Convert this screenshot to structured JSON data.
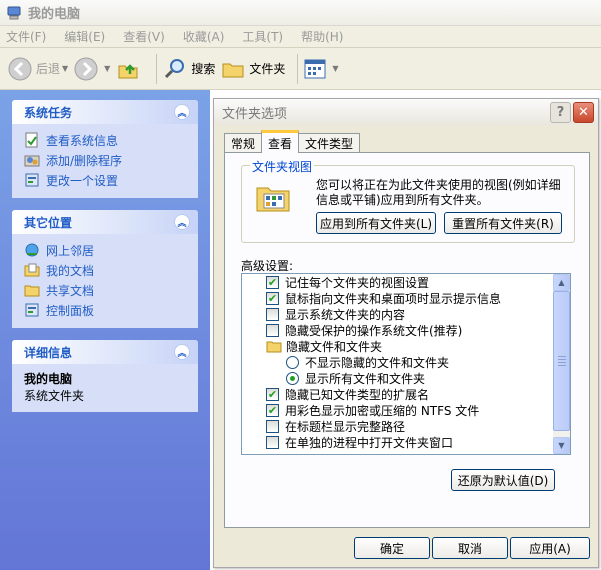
{
  "window": {
    "title": "我的电脑",
    "icon": "computer-icon"
  },
  "menubar": {
    "items": [
      "文件(F)",
      "编辑(E)",
      "查看(V)",
      "收藏(A)",
      "工具(T)",
      "帮助(H)"
    ]
  },
  "toolbar": {
    "back_label": "后退",
    "search_label": "搜索",
    "folders_label": "文件夹"
  },
  "taskpane": {
    "system_tasks": {
      "title": "系统任务",
      "items": [
        "查看系统信息",
        "添加/删除程序",
        "更改一个设置"
      ]
    },
    "other_places": {
      "title": "其它位置",
      "items": [
        "网上邻居",
        "我的文档",
        "共享文档",
        "控制面板"
      ]
    },
    "details": {
      "title": "详细信息",
      "name": "我的电脑",
      "type": "系统文件夹"
    }
  },
  "dialog": {
    "title": "文件夹选项",
    "help_symbol": "?",
    "close_symbol": "✕",
    "tabs": [
      "常规",
      "查看",
      "文件类型"
    ],
    "active_tab": "查看",
    "folder_views": {
      "legend": "文件夹视图",
      "description": "您可以将正在为此文件夹使用的视图(例如详细信息或平铺)应用到所有文件夹。",
      "apply_all_label": "应用到所有文件夹(L)",
      "reset_all_label": "重置所有文件夹(R)"
    },
    "advanced_label": "高级设置:",
    "advanced_items": [
      {
        "type": "checkbox",
        "checked": true,
        "label": "记住每个文件夹的视图设置"
      },
      {
        "type": "checkbox",
        "checked": true,
        "label": "鼠标指向文件夹和桌面项时显示提示信息"
      },
      {
        "type": "checkbox",
        "checked": false,
        "label": "显示系统文件夹的内容"
      },
      {
        "type": "checkbox",
        "checked": false,
        "label": "隐藏受保护的操作系统文件(推荐)"
      },
      {
        "type": "folder",
        "label": "隐藏文件和文件夹"
      },
      {
        "type": "radio",
        "checked": false,
        "label": "不显示隐藏的文件和文件夹"
      },
      {
        "type": "radio",
        "checked": true,
        "label": "显示所有文件和文件夹"
      },
      {
        "type": "checkbox",
        "checked": true,
        "label": "隐藏已知文件类型的扩展名"
      },
      {
        "type": "checkbox",
        "checked": true,
        "label": "用彩色显示加密或压缩的 NTFS 文件"
      },
      {
        "type": "checkbox",
        "checked": false,
        "label": "在标题栏显示完整路径"
      },
      {
        "type": "checkbox",
        "checked": false,
        "label": "在单独的进程中打开文件夹窗口"
      }
    ],
    "restore_defaults_label": "还原为默认值(D)",
    "ok_label": "确定",
    "cancel_label": "取消",
    "apply_label": "应用(A)"
  }
}
